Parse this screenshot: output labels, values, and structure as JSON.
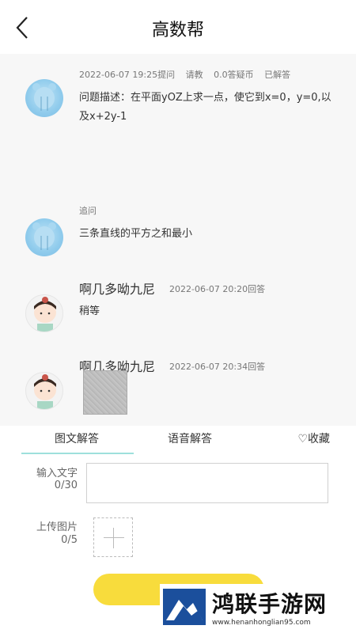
{
  "header": {
    "title": "高数帮"
  },
  "question": {
    "meta": [
      "2022-06-07 19:25提问",
      "请教",
      "0.0答疑币",
      "已解答"
    ],
    "text": "问题描述：在平面yOZ上求一点，使它到x=0，y=0,以及x+2y-1"
  },
  "followup": {
    "label": "追问",
    "text": "三条直线的平方之和最小"
  },
  "answers": [
    {
      "user": "啊几多呦九尼",
      "time": "2022-06-07 20:20回答",
      "text": "稍等"
    },
    {
      "user": "啊几多呦九尼",
      "time": "2022-06-07 20:34回答"
    }
  ],
  "tabs": {
    "text_answer": "图文解答",
    "voice_answer": "语音解答",
    "favorite": "♡收藏"
  },
  "form": {
    "input_label": "输入文字",
    "input_count": "0/30",
    "upload_label": "上传图片",
    "upload_count": "0/5"
  },
  "watermark": {
    "name": "鸿联手游网",
    "url": "www.henanhonglian95.com"
  },
  "colors": {
    "accent": "#f8dc3c",
    "tab_underline": "#9ee0dc"
  }
}
